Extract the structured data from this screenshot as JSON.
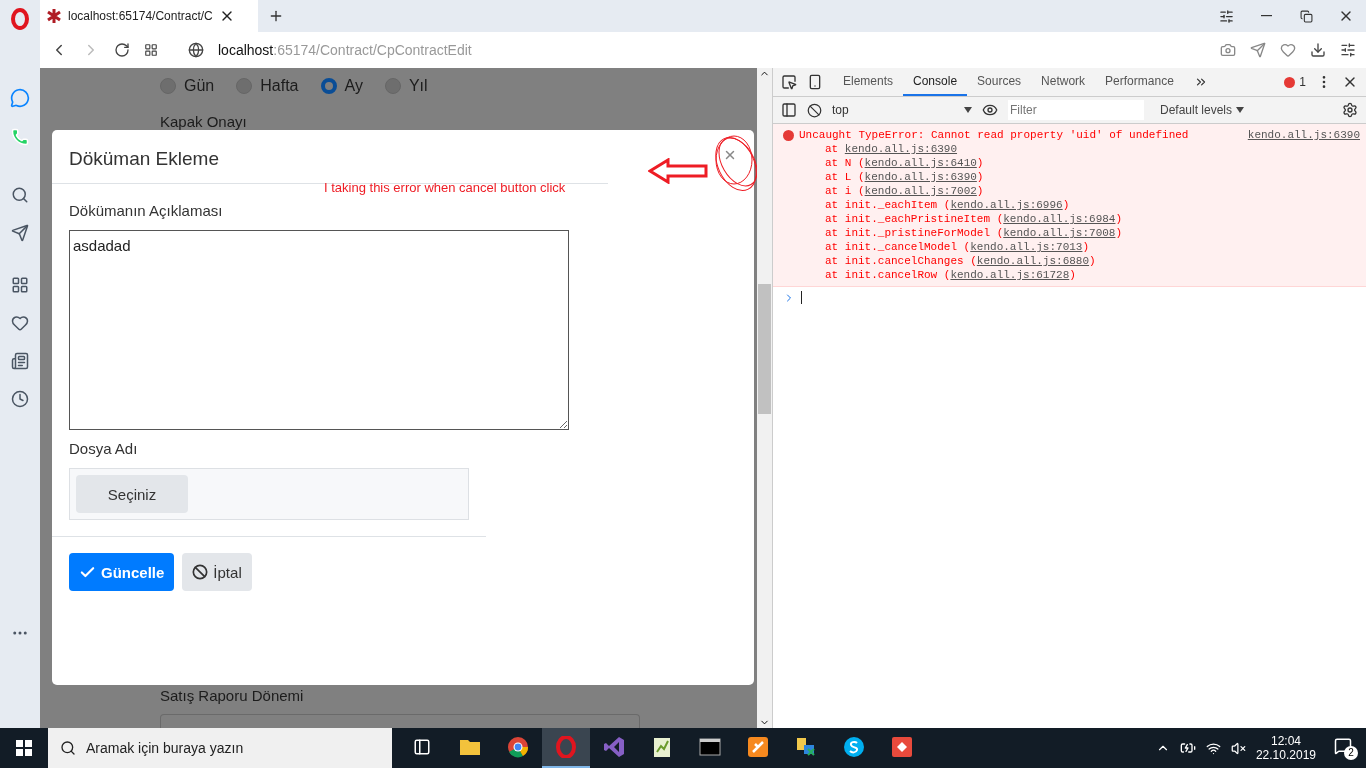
{
  "browser": {
    "tab_title": "localhost:65174/Contract/C",
    "url_host": "localhost",
    "url_path": ":65174/Contract/CpContractEdit"
  },
  "page": {
    "period_options": [
      {
        "label": "Gün",
        "selected": false
      },
      {
        "label": "Hafta",
        "selected": false
      },
      {
        "label": "Ay",
        "selected": true
      },
      {
        "label": "Yıl",
        "selected": false
      }
    ],
    "section_label": "Kapak Onayı",
    "bottom_label": "Satış Raporu Dönemi"
  },
  "modal": {
    "title": "Döküman Ekleme",
    "description_label": "Dökümanın Açıklaması",
    "description_value": "asdadad",
    "file_label": "Dosya Adı",
    "file_button": "Seçiniz",
    "buttons": [
      {
        "label": "Güncelle",
        "kind": "primary"
      },
      {
        "label": "İptal",
        "kind": "secondary"
      }
    ]
  },
  "annotation": {
    "text": "I taking this error  when cancel button click"
  },
  "devtools": {
    "tabs": [
      {
        "label": "Elements",
        "selected": false
      },
      {
        "label": "Console",
        "selected": true
      },
      {
        "label": "Sources",
        "selected": false
      },
      {
        "label": "Network",
        "selected": false
      },
      {
        "label": "Performance",
        "selected": false
      }
    ],
    "error_count": "1",
    "context": "top",
    "filter_placeholder": "Filter",
    "levels": "Default levels",
    "error": {
      "message": "Uncaught TypeError: Cannot read property 'uid' of undefined",
      "source": "kendo.all.js:6390",
      "stack": [
        {
          "before": "at ",
          "link": "kendo.all.js:6390"
        },
        {
          "before": "at N (",
          "link": "kendo.all.js:6410",
          "after": ")"
        },
        {
          "before": "at L (",
          "link": "kendo.all.js:6390",
          "after": ")"
        },
        {
          "before": "at i (",
          "link": "kendo.all.js:7002",
          "after": ")"
        },
        {
          "before": "at init._eachItem (",
          "link": "kendo.all.js:6996",
          "after": ")"
        },
        {
          "before": "at init._eachPristineItem (",
          "link": "kendo.all.js:6984",
          "after": ")"
        },
        {
          "before": "at init._pristineForModel (",
          "link": "kendo.all.js:7008",
          "after": ")"
        },
        {
          "before": "at init._cancelModel (",
          "link": "kendo.all.js:7013",
          "after": ")"
        },
        {
          "before": "at init.cancelChanges (",
          "link": "kendo.all.js:6880",
          "after": ")"
        },
        {
          "before": "at init.cancelRow (",
          "link": "kendo.all.js:61728",
          "after": ")"
        }
      ]
    }
  },
  "taskbar": {
    "search_placeholder": "Aramak için buraya yazın",
    "apps": [
      {
        "kind": "taskview",
        "selected": false
      },
      {
        "kind": "folder",
        "selected": false
      },
      {
        "kind": "chrome",
        "selected": false
      },
      {
        "kind": "opera",
        "selected": true
      },
      {
        "kind": "studio",
        "selected": false
      },
      {
        "kind": "notepad",
        "selected": false
      },
      {
        "kind": "terminal",
        "selected": false
      },
      {
        "kind": "sourcetree",
        "selected": false
      },
      {
        "kind": "network",
        "selected": false
      },
      {
        "kind": "skype",
        "selected": false
      },
      {
        "kind": "git",
        "selected": false
      }
    ],
    "time": "12:04",
    "date": "22.10.2019",
    "notification_count": "2"
  }
}
